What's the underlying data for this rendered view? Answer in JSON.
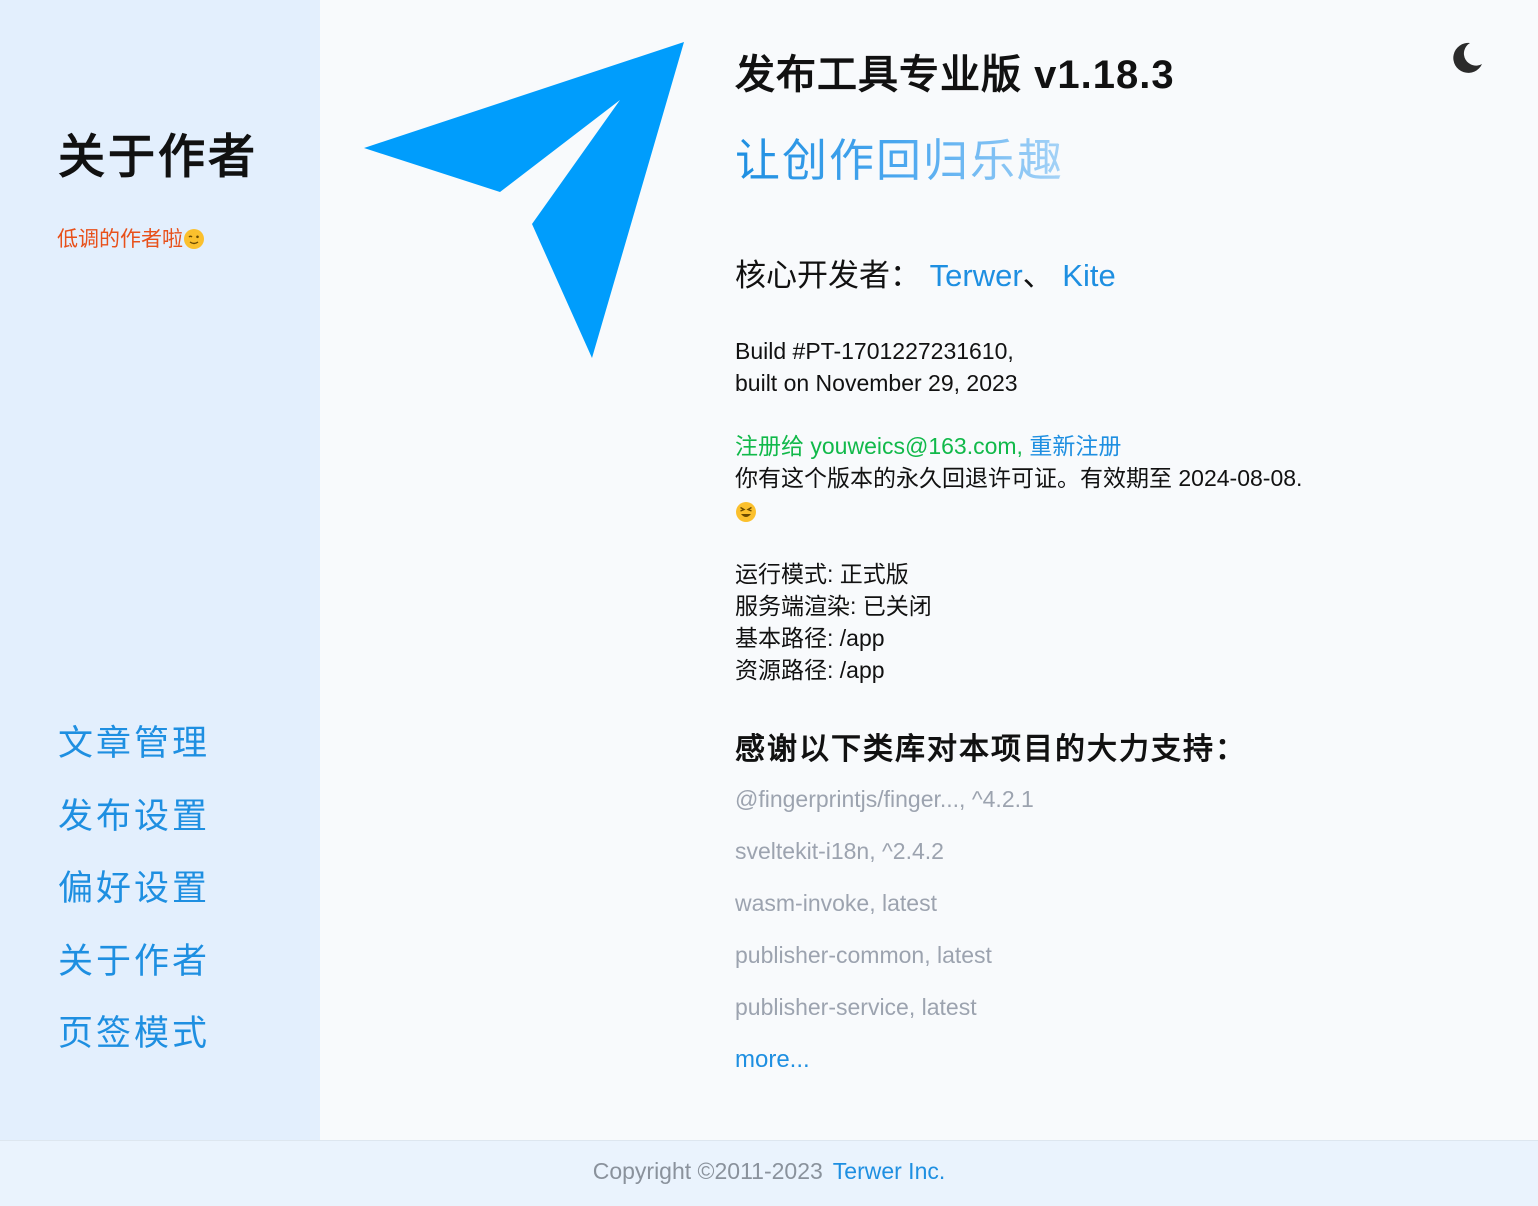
{
  "sidebar": {
    "title": "关于作者",
    "subtitle": "低调的作者啦",
    "subtitle_emoji": "winking-face-icon",
    "nav": [
      "文章管理",
      "发布设置",
      "偏好设置",
      "关于作者",
      "页签模式"
    ]
  },
  "header": {
    "app_title": "发布工具专业版 v1.18.3",
    "slogan": "让创作回归乐趣",
    "theme_toggle_icon": "moon-icon"
  },
  "developers": {
    "label": "核心开发者：",
    "names": [
      "Terwer",
      "Kite"
    ],
    "separator": "、"
  },
  "build": {
    "line1": "Build #PT-1701227231610,",
    "line2": "built on November 29, 2023"
  },
  "registration": {
    "registered_to": "注册给 youweics@163.com,",
    "re_register": "重新注册",
    "license": "你有这个版本的永久回退许可证。有效期至 2024-08-08."
  },
  "environment": [
    "运行模式: 正式版",
    "服务端渲染: 已关闭",
    "基本路径: /app",
    "资源路径: /app"
  ],
  "thanks": {
    "title": "感谢以下类库对本项目的大力支持：",
    "libs": [
      "@fingerprintjs/finger..., ^4.2.1",
      "sveltekit-i18n, ^2.4.2",
      "wasm-invoke, latest",
      "publisher-common, latest",
      "publisher-service, latest"
    ],
    "more": "more..."
  },
  "footer": {
    "copyright": "Copyright ©2011-2023",
    "company": "Terwer Inc."
  },
  "colors": {
    "accent": "#1e8fe1",
    "logo": "#009dfc",
    "sidebar_bg": "#e3effd",
    "subtitle": "#e8501a",
    "registered": "#11b94a",
    "muted": "#9ca3af"
  }
}
